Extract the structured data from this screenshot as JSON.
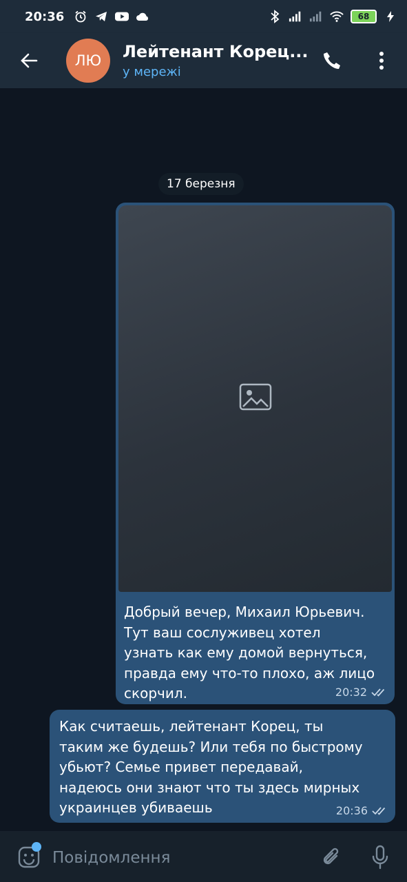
{
  "status_bar": {
    "time": "20:36",
    "battery": "68",
    "left_icons": [
      "alarm-icon",
      "telegram-icon",
      "youtube-icon",
      "cloud-icon"
    ],
    "right_icons": [
      "bluetooth-icon",
      "signal-icon",
      "signal-icon",
      "wifi-icon",
      "battery-icon",
      "charging-icon"
    ]
  },
  "header": {
    "avatar_initials": "ЛЮ",
    "avatar_color": "#e17c53",
    "title": "Лейтенант Корец...",
    "status": "у мережі",
    "icons": [
      "back-arrow-icon",
      "phone-icon",
      "more-vertical-icon"
    ]
  },
  "chat": {
    "date_chip": "17 березня",
    "messages": [
      {
        "direction": "out",
        "media": "photo",
        "text": "Добрый вечер, Михаил Юрьевич.\nТут ваш сослуживец хотел\nузнать как ему домой вернуться,\nправда ему что-то плохо, аж лицо\nскорчил.",
        "time": "20:32",
        "read": true
      },
      {
        "direction": "out",
        "text": "Как считаешь, лейтенант Корец, ты\nтаким же будешь? Или тебя по быстрому\nубьют? Семье привет передавай,\nнадеюсь они знают что ты здесь мирных\nукраинцев убиваешь",
        "time": "20:36",
        "read": true
      }
    ]
  },
  "composer": {
    "placeholder": "Повідомлення",
    "icons": [
      "emoji-icon",
      "attach-icon",
      "microphone-icon"
    ]
  },
  "colors": {
    "app_background": "#17212b",
    "chat_background": "#0e1621",
    "outgoing_bubble": "#2b5278",
    "accent": "#5eb5f7"
  }
}
